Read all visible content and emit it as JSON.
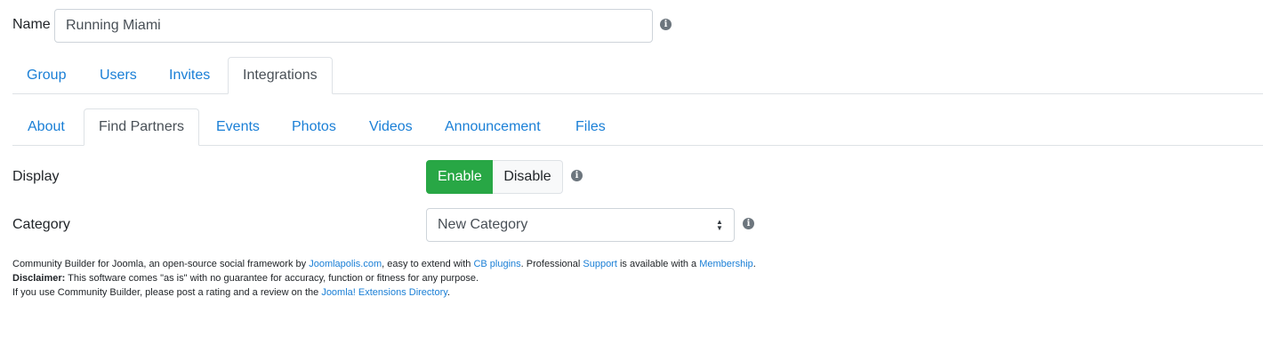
{
  "name_field": {
    "label": "Name",
    "value": "Running Miami"
  },
  "main_tabs": [
    {
      "label": "Group"
    },
    {
      "label": "Users"
    },
    {
      "label": "Invites"
    },
    {
      "label": "Integrations",
      "active": true
    }
  ],
  "sub_tabs": [
    {
      "label": "About"
    },
    {
      "label": "Find Partners",
      "active": true
    },
    {
      "label": "Events"
    },
    {
      "label": "Photos"
    },
    {
      "label": "Videos"
    },
    {
      "label": "Announcement"
    },
    {
      "label": "Files"
    }
  ],
  "display": {
    "label": "Display",
    "enable_label": "Enable",
    "disable_label": "Disable",
    "selected": "Enable"
  },
  "category": {
    "label": "Category",
    "value": "New Category"
  },
  "info_icon": "info-circle-icon",
  "colors": {
    "link": "#1a7fd6",
    "enable": "#28a745"
  },
  "footer": {
    "line1": {
      "t1": "Community Builder for Joomla, an open-source social framework by ",
      "link1": "Joomlapolis.com",
      "t2": ", easy to extend with ",
      "link2": "CB plugins",
      "t3": ". Professional ",
      "link3": "Support",
      "t4": " is available with a ",
      "link4": "Membership",
      "t5": "."
    },
    "line2": {
      "bold": "Disclaimer:",
      "text": " This software comes \"as is\" with no guarantee for accuracy, function or fitness for any purpose."
    },
    "line3": {
      "text": "If you use Community Builder, please post a rating and a review on the ",
      "link": "Joomla! Extensions Directory",
      "end": "."
    }
  }
}
